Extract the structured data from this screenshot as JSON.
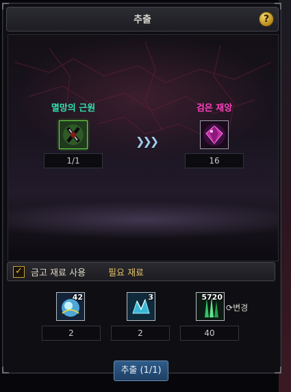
{
  "window": {
    "title": "추출",
    "help_icon": "?"
  },
  "source_item": {
    "name": "멸망의 근원",
    "count": "1/1",
    "icon": "dark-axe-icon"
  },
  "arrow_icon": "triple-chevron-right-icon",
  "target_item": {
    "name": "검은 재앙",
    "count": "16",
    "icon": "purple-gem-icon"
  },
  "materials_bar": {
    "checkbox_label": "금고 재료 사용",
    "checked": true,
    "required_label": "필요 재료"
  },
  "materials": [
    {
      "stack": "42",
      "count": "2",
      "icon": "blue-orb-icon"
    },
    {
      "stack": "3",
      "count": "2",
      "icon": "blue-crystal-icon"
    },
    {
      "stack": "5720",
      "count": "40",
      "icon": "green-shard-icon"
    }
  ],
  "change_label": "변경",
  "extract_button": "추출 (1/1)",
  "colors": {
    "source_name": "#33e0b0",
    "target_name": "#ff3fbf",
    "required_label": "#e6c46a",
    "button": "#2d5c8a"
  }
}
